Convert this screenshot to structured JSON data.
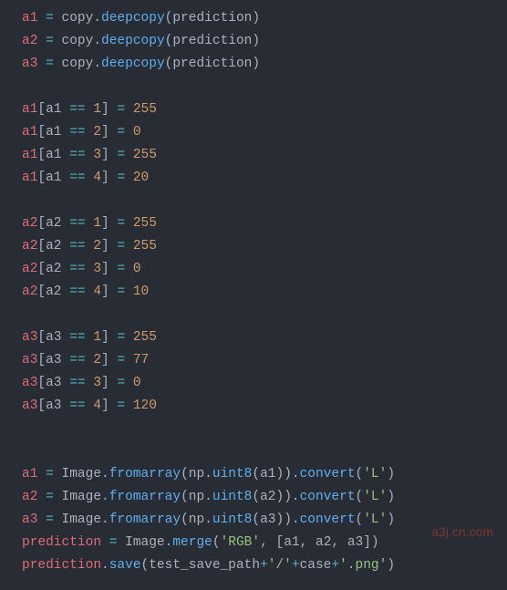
{
  "lines": [
    {
      "tokens": [
        {
          "t": "a1 ",
          "c": "var"
        },
        {
          "t": "= ",
          "c": "op"
        },
        {
          "t": "copy",
          "c": "plain"
        },
        {
          "t": ".",
          "c": "punct"
        },
        {
          "t": "deepcopy",
          "c": "func"
        },
        {
          "t": "(",
          "c": "punct"
        },
        {
          "t": "prediction",
          "c": "plain"
        },
        {
          "t": ")",
          "c": "punct"
        }
      ]
    },
    {
      "tokens": [
        {
          "t": "a2 ",
          "c": "var"
        },
        {
          "t": "= ",
          "c": "op"
        },
        {
          "t": "copy",
          "c": "plain"
        },
        {
          "t": ".",
          "c": "punct"
        },
        {
          "t": "deepcopy",
          "c": "func"
        },
        {
          "t": "(",
          "c": "punct"
        },
        {
          "t": "prediction",
          "c": "plain"
        },
        {
          "t": ")",
          "c": "punct"
        }
      ]
    },
    {
      "tokens": [
        {
          "t": "a3 ",
          "c": "var"
        },
        {
          "t": "= ",
          "c": "op"
        },
        {
          "t": "copy",
          "c": "plain"
        },
        {
          "t": ".",
          "c": "punct"
        },
        {
          "t": "deepcopy",
          "c": "func"
        },
        {
          "t": "(",
          "c": "punct"
        },
        {
          "t": "prediction",
          "c": "plain"
        },
        {
          "t": ")",
          "c": "punct"
        }
      ]
    },
    {
      "tokens": [
        {
          "t": " ",
          "c": "plain"
        }
      ]
    },
    {
      "tokens": [
        {
          "t": "a1",
          "c": "var"
        },
        {
          "t": "[",
          "c": "punct"
        },
        {
          "t": "a1 ",
          "c": "plain"
        },
        {
          "t": "== ",
          "c": "op"
        },
        {
          "t": "1",
          "c": "num"
        },
        {
          "t": "] ",
          "c": "punct"
        },
        {
          "t": "= ",
          "c": "op"
        },
        {
          "t": "255",
          "c": "num"
        }
      ]
    },
    {
      "tokens": [
        {
          "t": "a1",
          "c": "var"
        },
        {
          "t": "[",
          "c": "punct"
        },
        {
          "t": "a1 ",
          "c": "plain"
        },
        {
          "t": "== ",
          "c": "op"
        },
        {
          "t": "2",
          "c": "num"
        },
        {
          "t": "] ",
          "c": "punct"
        },
        {
          "t": "= ",
          "c": "op"
        },
        {
          "t": "0",
          "c": "num"
        }
      ]
    },
    {
      "tokens": [
        {
          "t": "a1",
          "c": "var"
        },
        {
          "t": "[",
          "c": "punct"
        },
        {
          "t": "a1 ",
          "c": "plain"
        },
        {
          "t": "== ",
          "c": "op"
        },
        {
          "t": "3",
          "c": "num"
        },
        {
          "t": "] ",
          "c": "punct"
        },
        {
          "t": "= ",
          "c": "op"
        },
        {
          "t": "255",
          "c": "num"
        }
      ]
    },
    {
      "tokens": [
        {
          "t": "a1",
          "c": "var"
        },
        {
          "t": "[",
          "c": "punct"
        },
        {
          "t": "a1 ",
          "c": "plain"
        },
        {
          "t": "== ",
          "c": "op"
        },
        {
          "t": "4",
          "c": "num"
        },
        {
          "t": "] ",
          "c": "punct"
        },
        {
          "t": "= ",
          "c": "op"
        },
        {
          "t": "20",
          "c": "num"
        }
      ]
    },
    {
      "tokens": [
        {
          "t": " ",
          "c": "plain"
        }
      ]
    },
    {
      "tokens": [
        {
          "t": "a2",
          "c": "var"
        },
        {
          "t": "[",
          "c": "punct"
        },
        {
          "t": "a2 ",
          "c": "plain"
        },
        {
          "t": "== ",
          "c": "op"
        },
        {
          "t": "1",
          "c": "num"
        },
        {
          "t": "] ",
          "c": "punct"
        },
        {
          "t": "= ",
          "c": "op"
        },
        {
          "t": "255",
          "c": "num"
        }
      ]
    },
    {
      "tokens": [
        {
          "t": "a2",
          "c": "var"
        },
        {
          "t": "[",
          "c": "punct"
        },
        {
          "t": "a2 ",
          "c": "plain"
        },
        {
          "t": "== ",
          "c": "op"
        },
        {
          "t": "2",
          "c": "num"
        },
        {
          "t": "] ",
          "c": "punct"
        },
        {
          "t": "= ",
          "c": "op"
        },
        {
          "t": "255",
          "c": "num"
        }
      ]
    },
    {
      "tokens": [
        {
          "t": "a2",
          "c": "var"
        },
        {
          "t": "[",
          "c": "punct"
        },
        {
          "t": "a2 ",
          "c": "plain"
        },
        {
          "t": "== ",
          "c": "op"
        },
        {
          "t": "3",
          "c": "num"
        },
        {
          "t": "] ",
          "c": "punct"
        },
        {
          "t": "= ",
          "c": "op"
        },
        {
          "t": "0",
          "c": "num"
        }
      ]
    },
    {
      "tokens": [
        {
          "t": "a2",
          "c": "var"
        },
        {
          "t": "[",
          "c": "punct"
        },
        {
          "t": "a2 ",
          "c": "plain"
        },
        {
          "t": "== ",
          "c": "op"
        },
        {
          "t": "4",
          "c": "num"
        },
        {
          "t": "] ",
          "c": "punct"
        },
        {
          "t": "= ",
          "c": "op"
        },
        {
          "t": "10",
          "c": "num"
        }
      ]
    },
    {
      "tokens": [
        {
          "t": " ",
          "c": "plain"
        }
      ]
    },
    {
      "tokens": [
        {
          "t": "a3",
          "c": "var"
        },
        {
          "t": "[",
          "c": "punct"
        },
        {
          "t": "a3 ",
          "c": "plain"
        },
        {
          "t": "== ",
          "c": "op"
        },
        {
          "t": "1",
          "c": "num"
        },
        {
          "t": "] ",
          "c": "punct"
        },
        {
          "t": "= ",
          "c": "op"
        },
        {
          "t": "255",
          "c": "num"
        }
      ]
    },
    {
      "tokens": [
        {
          "t": "a3",
          "c": "var"
        },
        {
          "t": "[",
          "c": "punct"
        },
        {
          "t": "a3 ",
          "c": "plain"
        },
        {
          "t": "== ",
          "c": "op"
        },
        {
          "t": "2",
          "c": "num"
        },
        {
          "t": "] ",
          "c": "punct"
        },
        {
          "t": "= ",
          "c": "op"
        },
        {
          "t": "77",
          "c": "num"
        }
      ]
    },
    {
      "tokens": [
        {
          "t": "a3",
          "c": "var"
        },
        {
          "t": "[",
          "c": "punct"
        },
        {
          "t": "a3 ",
          "c": "plain"
        },
        {
          "t": "== ",
          "c": "op"
        },
        {
          "t": "3",
          "c": "num"
        },
        {
          "t": "] ",
          "c": "punct"
        },
        {
          "t": "= ",
          "c": "op"
        },
        {
          "t": "0",
          "c": "num"
        }
      ]
    },
    {
      "tokens": [
        {
          "t": "a3",
          "c": "var"
        },
        {
          "t": "[",
          "c": "punct"
        },
        {
          "t": "a3 ",
          "c": "plain"
        },
        {
          "t": "== ",
          "c": "op"
        },
        {
          "t": "4",
          "c": "num"
        },
        {
          "t": "] ",
          "c": "punct"
        },
        {
          "t": "= ",
          "c": "op"
        },
        {
          "t": "120",
          "c": "num"
        }
      ]
    },
    {
      "tokens": [
        {
          "t": " ",
          "c": "plain"
        }
      ]
    },
    {
      "tokens": [
        {
          "t": " ",
          "c": "plain"
        }
      ]
    },
    {
      "tokens": [
        {
          "t": "a1 ",
          "c": "var"
        },
        {
          "t": "= ",
          "c": "op"
        },
        {
          "t": "Image",
          "c": "plain"
        },
        {
          "t": ".",
          "c": "punct"
        },
        {
          "t": "fromarray",
          "c": "func"
        },
        {
          "t": "(",
          "c": "punct"
        },
        {
          "t": "np",
          "c": "plain"
        },
        {
          "t": ".",
          "c": "punct"
        },
        {
          "t": "uint8",
          "c": "func"
        },
        {
          "t": "(",
          "c": "punct"
        },
        {
          "t": "a1",
          "c": "plain"
        },
        {
          "t": "))",
          "c": "punct"
        },
        {
          "t": ".",
          "c": "punct"
        },
        {
          "t": "convert",
          "c": "func"
        },
        {
          "t": "(",
          "c": "punct"
        },
        {
          "t": "'L'",
          "c": "str"
        },
        {
          "t": ")",
          "c": "punct"
        }
      ]
    },
    {
      "tokens": [
        {
          "t": "a2 ",
          "c": "var"
        },
        {
          "t": "= ",
          "c": "op"
        },
        {
          "t": "Image",
          "c": "plain"
        },
        {
          "t": ".",
          "c": "punct"
        },
        {
          "t": "fromarray",
          "c": "func"
        },
        {
          "t": "(",
          "c": "punct"
        },
        {
          "t": "np",
          "c": "plain"
        },
        {
          "t": ".",
          "c": "punct"
        },
        {
          "t": "uint8",
          "c": "func"
        },
        {
          "t": "(",
          "c": "punct"
        },
        {
          "t": "a2",
          "c": "plain"
        },
        {
          "t": "))",
          "c": "punct"
        },
        {
          "t": ".",
          "c": "punct"
        },
        {
          "t": "convert",
          "c": "func"
        },
        {
          "t": "(",
          "c": "punct"
        },
        {
          "t": "'L'",
          "c": "str"
        },
        {
          "t": ")",
          "c": "punct"
        }
      ]
    },
    {
      "tokens": [
        {
          "t": "a3 ",
          "c": "var"
        },
        {
          "t": "= ",
          "c": "op"
        },
        {
          "t": "Image",
          "c": "plain"
        },
        {
          "t": ".",
          "c": "punct"
        },
        {
          "t": "fromarray",
          "c": "func"
        },
        {
          "t": "(",
          "c": "punct"
        },
        {
          "t": "np",
          "c": "plain"
        },
        {
          "t": ".",
          "c": "punct"
        },
        {
          "t": "uint8",
          "c": "func"
        },
        {
          "t": "(",
          "c": "punct"
        },
        {
          "t": "a3",
          "c": "plain"
        },
        {
          "t": "))",
          "c": "punct"
        },
        {
          "t": ".",
          "c": "punct"
        },
        {
          "t": "convert",
          "c": "func"
        },
        {
          "t": "(",
          "c": "punct"
        },
        {
          "t": "'L'",
          "c": "str"
        },
        {
          "t": ")",
          "c": "punct"
        }
      ]
    },
    {
      "tokens": [
        {
          "t": "prediction ",
          "c": "var"
        },
        {
          "t": "= ",
          "c": "op"
        },
        {
          "t": "Image",
          "c": "plain"
        },
        {
          "t": ".",
          "c": "punct"
        },
        {
          "t": "merge",
          "c": "func"
        },
        {
          "t": "(",
          "c": "punct"
        },
        {
          "t": "'RGB'",
          "c": "str"
        },
        {
          "t": ", [",
          "c": "punct"
        },
        {
          "t": "a1",
          "c": "plain"
        },
        {
          "t": ", ",
          "c": "punct"
        },
        {
          "t": "a2",
          "c": "plain"
        },
        {
          "t": ", ",
          "c": "punct"
        },
        {
          "t": "a3",
          "c": "plain"
        },
        {
          "t": "])",
          "c": "punct"
        }
      ]
    },
    {
      "tokens": [
        {
          "t": "prediction",
          "c": "var"
        },
        {
          "t": ".",
          "c": "punct"
        },
        {
          "t": "save",
          "c": "func"
        },
        {
          "t": "(",
          "c": "punct"
        },
        {
          "t": "test_save_path",
          "c": "plain"
        },
        {
          "t": "+",
          "c": "op"
        },
        {
          "t": "'/'",
          "c": "str"
        },
        {
          "t": "+",
          "c": "op"
        },
        {
          "t": "case",
          "c": "plain"
        },
        {
          "t": "+",
          "c": "op"
        },
        {
          "t": "'.png'",
          "c": "str"
        },
        {
          "t": ")",
          "c": "punct"
        }
      ]
    }
  ],
  "watermark": "a3j.cn.com"
}
